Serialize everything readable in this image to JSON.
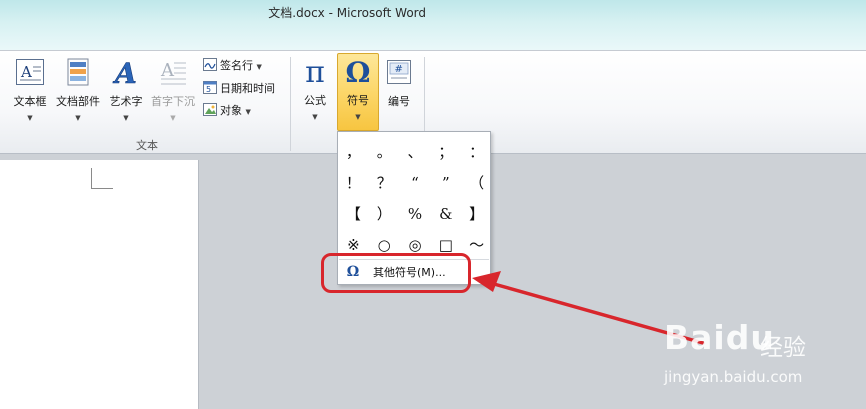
{
  "window": {
    "title": "文档.docx - Microsoft Word"
  },
  "ribbon": {
    "text_group": {
      "label": "文本",
      "buttons": [
        {
          "label": "文本框",
          "icon": "text-box-icon"
        },
        {
          "label": "文档部件",
          "icon": "quick-parts-icon"
        },
        {
          "label": "艺术字",
          "icon": "wordart-icon"
        },
        {
          "label": "首字下沉",
          "icon": "drop-cap-icon",
          "disabled": true
        }
      ],
      "small_items": [
        {
          "label": "签名行",
          "icon": "signature-line-icon"
        },
        {
          "label": "日期和时间",
          "icon": "date-time-icon"
        },
        {
          "label": "对象",
          "icon": "object-icon"
        }
      ]
    },
    "symbols_group": {
      "buttons": [
        {
          "label": "公式",
          "icon": "pi-icon",
          "glyph": "π"
        },
        {
          "label": "符号",
          "icon": "omega-icon",
          "glyph": "Ω",
          "active": true
        },
        {
          "label": "编号",
          "icon": "number-icon",
          "glyph": "#"
        }
      ]
    }
  },
  "symbol_dropdown": {
    "symbols": [
      [
        "，",
        "。",
        "、",
        "；",
        "："
      ],
      [
        "！",
        "？",
        "“",
        "”",
        "（"
      ],
      [
        "【",
        "）",
        "%",
        "&",
        "】"
      ],
      [
        "※",
        "○",
        "◎",
        "□",
        "～"
      ]
    ],
    "more_symbols": {
      "icon": "omega-icon",
      "glyph": "Ω",
      "label": "其他符号(M)..."
    }
  },
  "watermark": {
    "logo": "Baidu",
    "text": "经验",
    "url": "jingyan.baidu.com"
  },
  "colors": {
    "highlight": "#fcd76a",
    "annotation_red": "#d8262c",
    "accent_blue": "#1e4f9a"
  }
}
